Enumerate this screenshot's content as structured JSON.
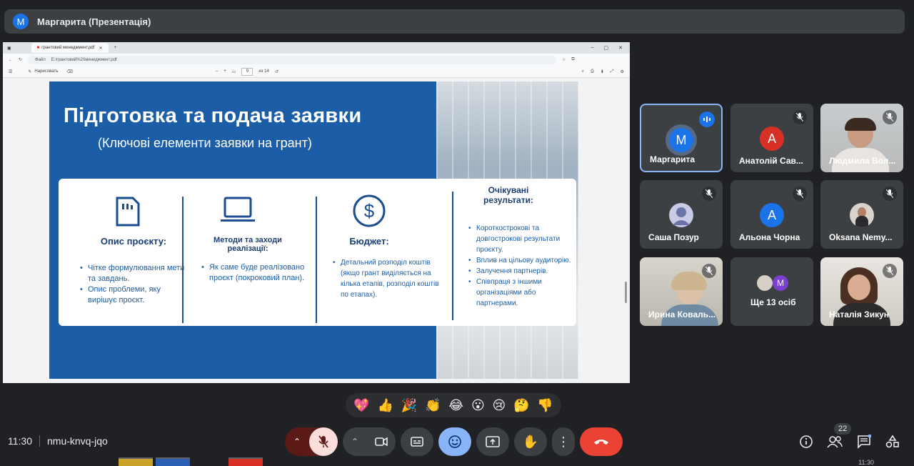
{
  "meeting": {
    "presenter_initial": "M",
    "presenter_banner": "Маргарита (Презентація)",
    "time": "11:30",
    "code": "nmu-knvq-jqo",
    "participants_count": "22"
  },
  "browser": {
    "tab_title": "грантовий менеджмент.pdf",
    "url_prefix": "Файл",
    "url": "E:/грантовий%20менеджмент.pdf",
    "draw_label": "Нарисовать",
    "page_current": "9",
    "page_total": "из 14"
  },
  "slide": {
    "title": "Підготовка та подача заявки",
    "subtitle": "(Ключові елементи заявки на грант)",
    "columns": [
      {
        "title": "Опис проєкту:",
        "items": [
          "Чітке формулювання мети та завдань.",
          "Опис проблеми, яку вирішує проєкт."
        ]
      },
      {
        "title": "Методи та заходи реалізації:",
        "items": [
          "Як саме буде реалізовано проєкт (покроковий план)."
        ]
      },
      {
        "title": "Бюджет:",
        "items": [
          "Детальний розподіл коштів (якщо грант виділяється на кілька етапів, розподіл коштів по етапах)."
        ]
      },
      {
        "title": "Очікувані результати:",
        "items": [
          "Короткострокові та довгострокові результати проєкту.",
          "Вплив на цільову аудиторію.",
          "Залучення партнерів.",
          "Співпраця з іншими організаціями або партнерами."
        ]
      }
    ]
  },
  "participants": [
    {
      "name": "Маргарита",
      "initial": "M",
      "color": "#1a73e8",
      "speaking": true
    },
    {
      "name": "Анатолій Сав...",
      "initial": "А",
      "color": "#d93025",
      "muted": true
    },
    {
      "name": "Людмила Вол...",
      "muted": true,
      "video": true
    },
    {
      "name": "Саша Позур",
      "muted": true,
      "avatar_kind": "default-profile"
    },
    {
      "name": "Альона Чорна",
      "initial": "А",
      "color": "#1a73e8",
      "muted": true
    },
    {
      "name": "Oksana Nemy...",
      "muted": true,
      "avatar_kind": "photo"
    },
    {
      "name": "Ирина Коваль...",
      "muted": true,
      "video": true
    },
    {
      "name": "Ще 13 осіб",
      "initial": "M",
      "color": "#7b3fd1"
    },
    {
      "name": "Наталія Зикун",
      "muted": true,
      "video": true
    }
  ],
  "reactions": [
    "💖",
    "👍",
    "🎉",
    "👏",
    "😂",
    "😮",
    "😢",
    "🤔",
    "👎"
  ],
  "taskbar": {
    "clock": "11:30"
  }
}
